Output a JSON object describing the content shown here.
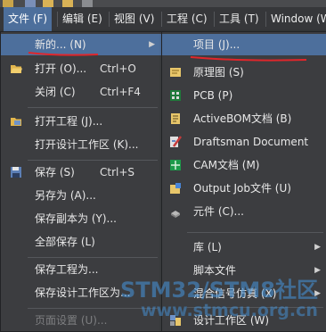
{
  "menubar": {
    "items": [
      {
        "label": "文件 (F)"
      },
      {
        "label": "编辑 (E)"
      },
      {
        "label": "视图 (V)"
      },
      {
        "label": "工程 (C)"
      },
      {
        "label": "工具 (T)"
      },
      {
        "label": "Window (W"
      }
    ]
  },
  "file_menu": {
    "items": [
      {
        "label": "新的... (N)",
        "shortcut": ""
      },
      {
        "label": "打开 (O)...",
        "shortcut": "Ctrl+O"
      },
      {
        "label": "关闭 (C)",
        "shortcut": "Ctrl+F4"
      },
      {
        "label": "打开工程 (J)...",
        "shortcut": ""
      },
      {
        "label": "打开设计工作区 (K)...",
        "shortcut": ""
      },
      {
        "label": "保存 (S)",
        "shortcut": "Ctrl+S"
      },
      {
        "label": "另存为 (A)...",
        "shortcut": ""
      },
      {
        "label": "保存副本为 (Y)...",
        "shortcut": ""
      },
      {
        "label": "全部保存 (L)",
        "shortcut": ""
      },
      {
        "label": "保存工程为...",
        "shortcut": ""
      },
      {
        "label": "保存设计工作区为...",
        "shortcut": ""
      },
      {
        "label": "页面设置 (U)...",
        "shortcut": ""
      }
    ]
  },
  "new_submenu": {
    "items": [
      {
        "label": "项目 (J)..."
      },
      {
        "label": "原理图 (S)"
      },
      {
        "label": "PCB (P)"
      },
      {
        "label": "ActiveBOM文档 (B)"
      },
      {
        "label": "Draftsman Document"
      },
      {
        "label": "CAM文档 (M)"
      },
      {
        "label": "Output Job文件 (U)"
      },
      {
        "label": "元件 (C)..."
      },
      {
        "label": "库 (L)"
      },
      {
        "label": "脚本文件"
      },
      {
        "label": "混合信号仿真 (X)"
      },
      {
        "label": "设计工作区 (W)"
      }
    ]
  },
  "watermark": {
    "line1": "STM32/STM8社区",
    "line2": "www.stmcu.org.cn"
  },
  "colors": {
    "highlight": "#4d6f9c",
    "annotation": "#e0262b"
  }
}
